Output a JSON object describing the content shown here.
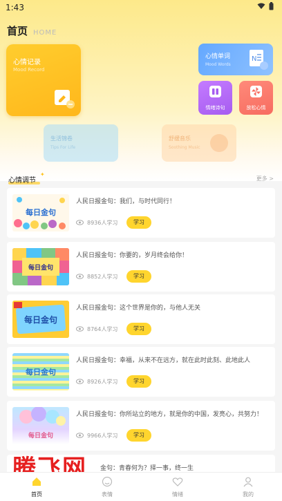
{
  "status_bar": {
    "time": "1:43"
  },
  "header": {
    "title": "首页",
    "subtitle": "HOME"
  },
  "cards": {
    "mood_record": {
      "title": "心情记录",
      "subtitle": "Mood Record"
    },
    "mood_words": {
      "title": "心情单词",
      "subtitle": "Mood Words"
    },
    "mood_poem": {
      "title": "情绪诗句"
    },
    "relax": {
      "title": "放松心情"
    },
    "life_tips": {
      "title": "生活锦卷",
      "subtitle": "Tips For Life"
    },
    "soothing_music": {
      "title": "舒缓音乐",
      "subtitle": "Soothing Music"
    }
  },
  "section": {
    "title": "心情调节",
    "more": "更多 >"
  },
  "items": [
    {
      "thumb_text": "每日金句",
      "title": "人民日报金句：我们，与时代同行！",
      "count": "8936人学习",
      "button": "学习"
    },
    {
      "thumb_text": "每日金句",
      "title": "人民日报金句：你要的，岁月终会给你！",
      "count": "8852人学习",
      "button": "学习"
    },
    {
      "thumb_text": "每日金句",
      "title": "人民日报金句：这个世界是你的，与他人无关",
      "count": "8764人学习",
      "button": "学习"
    },
    {
      "thumb_text": "每日金句",
      "title": "人民日报金句：幸福，从来不在远方，就在此时此刻、此地此人",
      "count": "8926人学习",
      "button": "学习"
    },
    {
      "thumb_text": "每日金句",
      "title": "人民日报金句：你所站立的地方，就是你的中国，发亮心，共努力！",
      "count": "9966人学习",
      "button": "学习"
    }
  ],
  "partial_item": {
    "title": "金句：青春何为？择一事，终一生"
  },
  "watermark": "腾飞网",
  "bottom_nav": [
    {
      "label": "首页",
      "icon": "home-icon",
      "active": true
    },
    {
      "label": "表情",
      "icon": "emoji-icon",
      "active": false
    },
    {
      "label": "情绪",
      "icon": "heart-icon",
      "active": false
    },
    {
      "label": "我的",
      "icon": "profile-icon",
      "active": false
    }
  ],
  "colors": {
    "accent": "#ffd52e",
    "brand_yellow": "#ffc21a",
    "blue_card": "#64a8ff",
    "purple_card": "#a65cf0",
    "red_card": "#f76c60"
  }
}
